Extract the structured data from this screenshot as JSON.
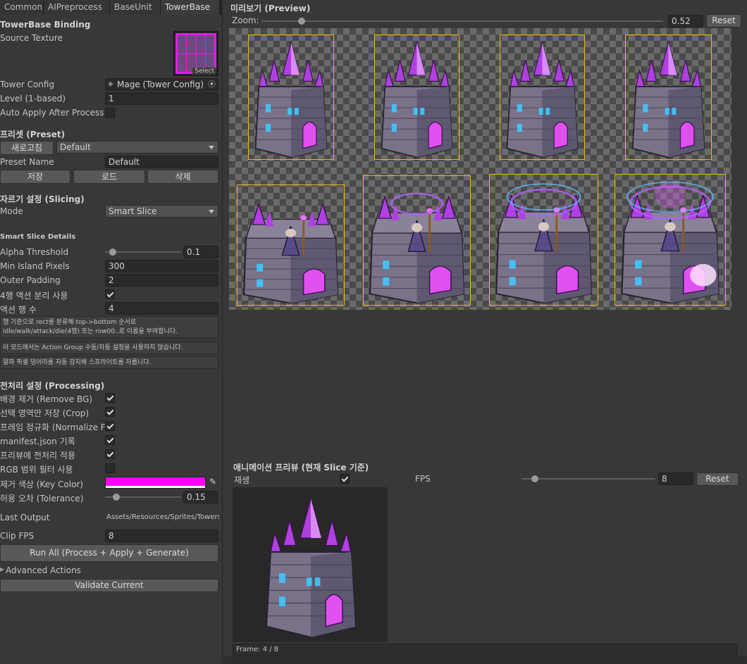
{
  "tabs": [
    "Common",
    "AIPreprocess",
    "BaseUnit",
    "TowerBase"
  ],
  "binding": {
    "section_title": "TowerBase Binding",
    "source_texture_label": "Source Texture",
    "select_label": "Select",
    "tower_config_label": "Tower Config",
    "tower_config_value": "Mage (Tower Config)",
    "level_label": "Level (1-based)",
    "level_value": "1",
    "auto_apply_label": "Auto Apply After Process"
  },
  "preset": {
    "section_title": "프리셋 (Preset)",
    "refresh_button": "새로고침",
    "dropdown_value": "Default",
    "name_label": "Preset Name",
    "name_value": "Default",
    "save_button": "저장",
    "load_button": "로드",
    "delete_button": "삭제"
  },
  "slicing": {
    "section_title": "자르기 설정 (Slicing)",
    "mode_label": "Mode",
    "mode_value": "Smart Slice",
    "details_title": "Smart Slice Details",
    "alpha_label": "Alpha Threshold",
    "alpha_value": "0.1",
    "alpha_fraction": 0.1,
    "min_island_label": "Min Island Pixels",
    "min_island_value": "300",
    "outer_padding_label": "Outer Padding",
    "outer_padding_value": "2",
    "four_row_label": "4행 액션 분리 사용",
    "action_rows_label": "액션 행 수",
    "action_rows_value": "4",
    "info1_line1": "행 기준으로 rect를 분류해 top->bottom 순서로",
    "info1_line2": "idle/walk/attack/die(4행) 또는 row00..로 이름을 부여합니다.",
    "info2": "이 모드에서는 Action Group 수동/자동 설정을 사용하지 않습니다.",
    "info3": "알파 픽셀 덩어리를 자동 감지해 스프라이트를 자릅니다."
  },
  "processing": {
    "section_title": "전처리 설정 (Processing)",
    "remove_bg_label": "배경 제거 (Remove BG)",
    "crop_label": "선택 영역만 저장 (Crop)",
    "normalize_label": "프레임 정규화 (Normalize F",
    "manifest_label": "manifest.json 기록",
    "apply_preview_label": "프리뷰에 전처리 적용",
    "rgb_filter_label": "RGB 범위 필터 사용",
    "key_color_label": "제거 색상 (Key Color)",
    "key_color": "#ff00ff",
    "tolerance_label": "허용 오차 (Tolerance)",
    "tolerance_value": "0.15",
    "tolerance_fraction": 0.15,
    "last_output_label": "Last Output",
    "last_output_value": "Assets/Resources/Sprites/Towers/",
    "clip_fps_label": "Clip FPS",
    "clip_fps_value": "8",
    "run_all_button": "Run All (Process + Apply + Generate)",
    "advanced_label": "Advanced Actions",
    "validate_button": "Validate Current"
  },
  "preview": {
    "title": "미리보기 (Preview)",
    "zoom_label": "Zoom:",
    "zoom_value": "0.52",
    "zoom_fraction": 0.1,
    "reset_button": "Reset"
  },
  "animation": {
    "title": "애니메이션 프리뷰 (현재 Slice 기준)",
    "play_label": "재생",
    "fps_label": "FPS",
    "fps_value": "8",
    "fps_fraction": 0.1,
    "reset_button": "Reset",
    "frame_text": "Frame: 4 / 8"
  },
  "colors": {
    "frame_border": "#e8b818",
    "crystal": "#b040e0",
    "stone": "#7a7288",
    "rune": "#40c8ff"
  },
  "icons": [
    "object-picker-icon",
    "eyedropper-icon",
    "foldout-arrow-icon",
    "dropdown-arrow-icon",
    "checkmark-icon"
  ]
}
